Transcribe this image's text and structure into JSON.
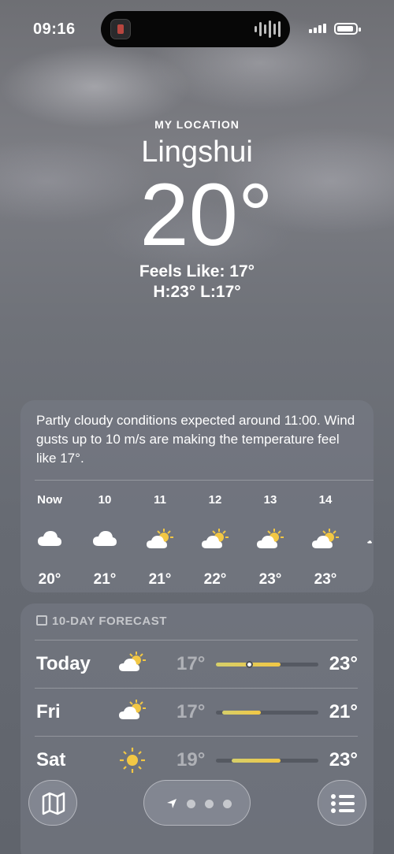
{
  "status_bar": {
    "time": "09:16"
  },
  "location": {
    "header": "MY LOCATION",
    "city": "Lingshui",
    "temperature": "20°",
    "feels_like": "Feels Like: 17°",
    "high_low": "H:23°  L:17°"
  },
  "summary": "Partly cloudy conditions expected around 11:00. Wind gusts up to 10 m/s are making the temperature feel like 17°.",
  "hourly": [
    {
      "label": "Now",
      "icon": "cloud-icon",
      "temp": "20°"
    },
    {
      "label": "10",
      "icon": "cloud-icon",
      "temp": "21°"
    },
    {
      "label": "11",
      "icon": "partly-sunny-icon",
      "temp": "21°"
    },
    {
      "label": "12",
      "icon": "partly-sunny-icon",
      "temp": "22°"
    },
    {
      "label": "13",
      "icon": "partly-sunny-icon",
      "temp": "23°"
    },
    {
      "label": "14",
      "icon": "partly-sunny-icon",
      "temp": "23°"
    }
  ],
  "forecast": {
    "header": "10-DAY FORECAST",
    "days": [
      {
        "day": "Today",
        "icon": "partly-sunny-icon",
        "low": "17°",
        "high": "23°",
        "range_start": 0.0,
        "range_end": 0.63,
        "current": 0.32
      },
      {
        "day": "Fri",
        "icon": "partly-sunny-icon",
        "low": "17°",
        "high": "21°",
        "range_start": 0.06,
        "range_end": 0.44
      },
      {
        "day": "Sat",
        "icon": "sun-icon",
        "low": "19°",
        "high": "23°",
        "range_start": 0.15,
        "range_end": 0.63
      }
    ]
  },
  "colors": {
    "sun": "#f2c744",
    "range_fill": "#e8cf55"
  },
  "toolbar": {
    "left_icon": "map-icon",
    "right_icon": "list-icon",
    "center_icon": "location-arrow-icon"
  }
}
